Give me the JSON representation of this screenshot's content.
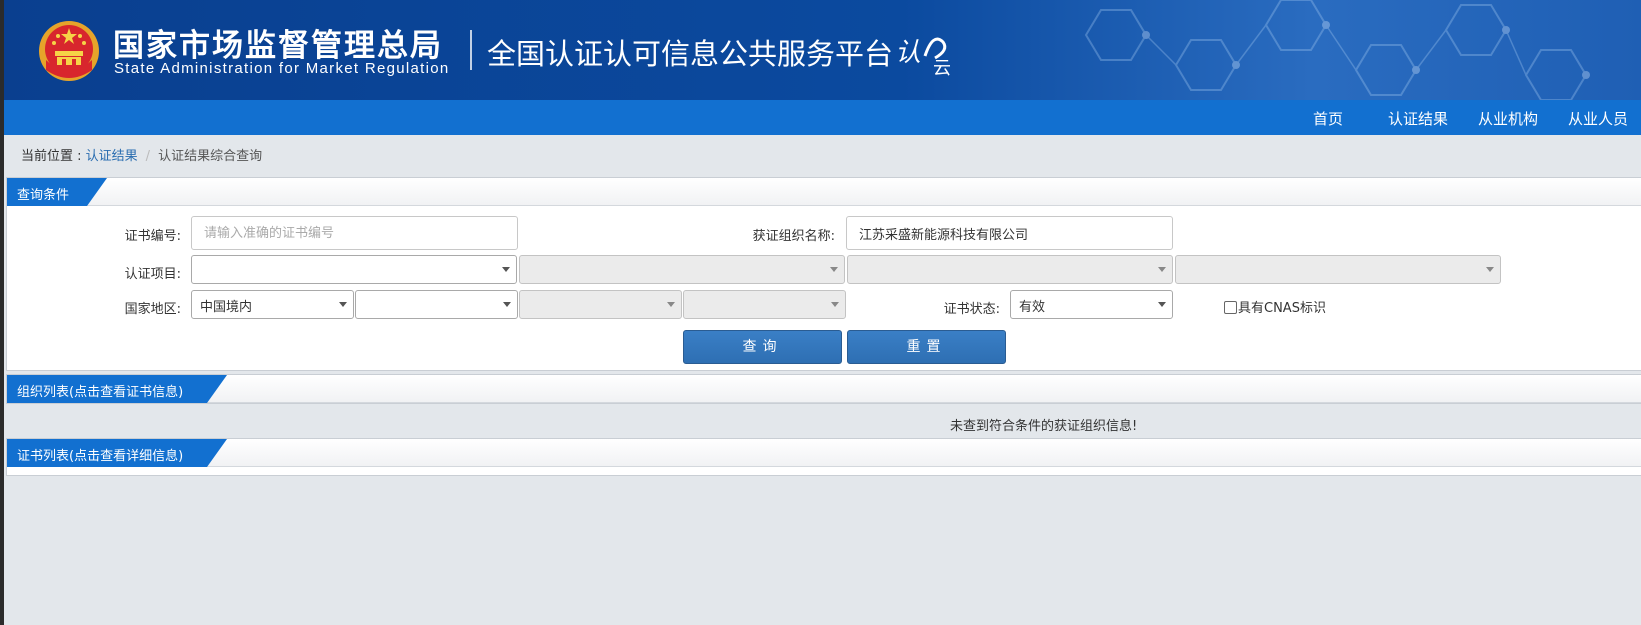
{
  "header": {
    "org_cn": "国家市场监督管理总局",
    "org_en": "State Administration  for  Market Regulation",
    "platform_title": "全国认证认可信息公共服务平台",
    "logo_text_1": "认",
    "logo_text_2": "云"
  },
  "nav": {
    "items": [
      "首页",
      "认证结果",
      "从业机构",
      "从业人员"
    ]
  },
  "breadcrumb": {
    "label": "当前位置 : ",
    "link": "认证结果",
    "separator": "/",
    "current": "认证结果综合查询"
  },
  "query_panel": {
    "title": "查询条件",
    "cert_no_label": "证书编号:",
    "cert_no_placeholder": "请输入准确的证书编号",
    "cert_no_value": "",
    "org_name_label": "获证组织名称:",
    "org_name_value": "江苏采盛新能源科技有限公司",
    "cert_project_label": "认证项目:",
    "project_selects": [
      "",
      "",
      "",
      ""
    ],
    "region_label": "国家地区:",
    "region_selects": [
      "中国境内",
      "",
      "",
      ""
    ],
    "status_label": "证书状态:",
    "status_value": "有效",
    "cnas_label": "具有CNAS标识",
    "cnas_checked": false,
    "search_button": "查询",
    "reset_button": "重置"
  },
  "org_list_panel": {
    "title": "组织列表(点击查看证书信息)",
    "empty_message": "未查到符合条件的获证组织信息!"
  },
  "cert_list_panel": {
    "title": "证书列表(点击查看详细信息)"
  },
  "colors": {
    "banner": "#0b4a9f",
    "navbar": "#1270d0",
    "tab": "#1270d0",
    "button": "#2e6fb3",
    "link": "#2a6db0",
    "page_bg": "#e3e7eb"
  },
  "icons": {
    "emblem": "national-emblem-icon",
    "logo": "renke-yun-logo-icon",
    "dropdown": "chevron-down-icon"
  }
}
